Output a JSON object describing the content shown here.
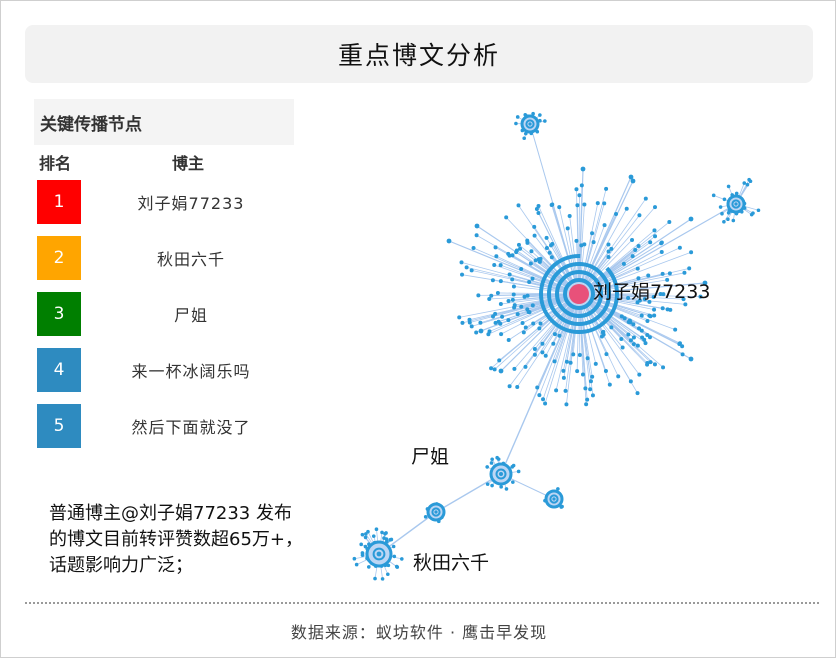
{
  "title": "重点博文分析",
  "panel": {
    "heading": "关键传播节点",
    "col_rank": "排名",
    "col_user": "博主",
    "rows": [
      {
        "rank": "1",
        "name": "刘子娟77233",
        "color": "#ff0000"
      },
      {
        "rank": "2",
        "name": "秋田六千",
        "color": "#ffa500"
      },
      {
        "rank": "3",
        "name": "尸姐",
        "color": "#007f00"
      },
      {
        "rank": "4",
        "name": "来一杯冰阔乐吗",
        "color": "#2e8bc0"
      },
      {
        "rank": "5",
        "name": "然后下面就没了",
        "color": "#2e8bc0"
      }
    ]
  },
  "note": {
    "line1": "普通博主@刘子娟77233 发布",
    "line2": "的博文目前转评赞数超65万+，",
    "line3": "话题影响力广泛；"
  },
  "network": {
    "labels": {
      "center": "刘子娟77233",
      "node_a": "尸姐",
      "node_b": "秋田六千"
    },
    "node_color": "#2a9ad8",
    "edge_color": "#a9c8ee",
    "center_color": "#e8517a"
  },
  "footer": "数据来源：蚁坊软件 · 鹰击早发现"
}
